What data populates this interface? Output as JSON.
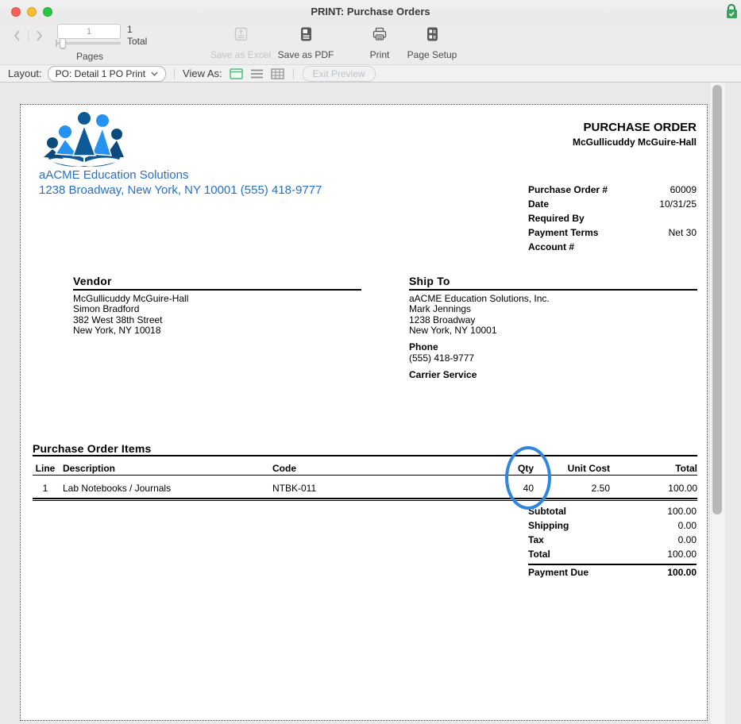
{
  "window": {
    "title": "PRINT: Purchase Orders"
  },
  "toolbar": {
    "pages_value": "1",
    "total_value": "1",
    "total_label": "Total",
    "pages_label": "Pages",
    "save_excel_label": "Save as Excel",
    "save_pdf_label": "Save as PDF",
    "print_label": "Print",
    "page_setup_label": "Page Setup"
  },
  "layout_bar": {
    "layout_label": "Layout:",
    "layout_value": "PO: Detail 1 PO Print",
    "view_as_label": "View As:",
    "exit_preview_label": "Exit Preview"
  },
  "po": {
    "company_name": "aACME Education Solutions",
    "company_address": "1238 Broadway, New York, NY 10001 (555) 418-9777",
    "title": "PURCHASE ORDER",
    "header_vendor_name": "McGullicuddy McGuire-Hall",
    "info": [
      {
        "label": "Purchase Order #",
        "value": "60009"
      },
      {
        "label": "Date",
        "value": "10/31/25"
      },
      {
        "label": "Required By",
        "value": ""
      },
      {
        "label": "Payment Terms",
        "value": "Net 30"
      },
      {
        "label": "Account #",
        "value": ""
      }
    ],
    "vendor": {
      "title": "Vendor",
      "lines": [
        "McGullicuddy McGuire-Hall",
        "Simon Bradford",
        "382 West 38th Street",
        "New York, NY 10018"
      ]
    },
    "ship_to": {
      "title": "Ship To",
      "lines": [
        "aACME Education Solutions, Inc.",
        "Mark Jennings",
        "1238 Broadway",
        "New York, NY 10001"
      ],
      "phone_label": "Phone",
      "phone": "(555) 418-9777",
      "carrier_label": "Carrier Service"
    },
    "items": {
      "title": "Purchase Order Items",
      "columns": [
        "Line",
        "Description",
        "Code",
        "Qty",
        "Unit Cost",
        "Total"
      ],
      "rows": [
        {
          "line": "1",
          "description": "Lab Notebooks / Journals",
          "code": "NTBK-011",
          "qty": "40",
          "unit_cost": "2.50",
          "total": "100.00"
        }
      ]
    },
    "totals": [
      {
        "label": "Subtotal",
        "value": "100.00"
      },
      {
        "label": "Shipping",
        "value": "0.00"
      },
      {
        "label": "Tax",
        "value": "0.00"
      },
      {
        "label": "Total",
        "value": "100.00"
      }
    ],
    "payment_due": {
      "label": "Payment Due",
      "value": "100.00"
    },
    "annotation_color": "#2e86de"
  }
}
